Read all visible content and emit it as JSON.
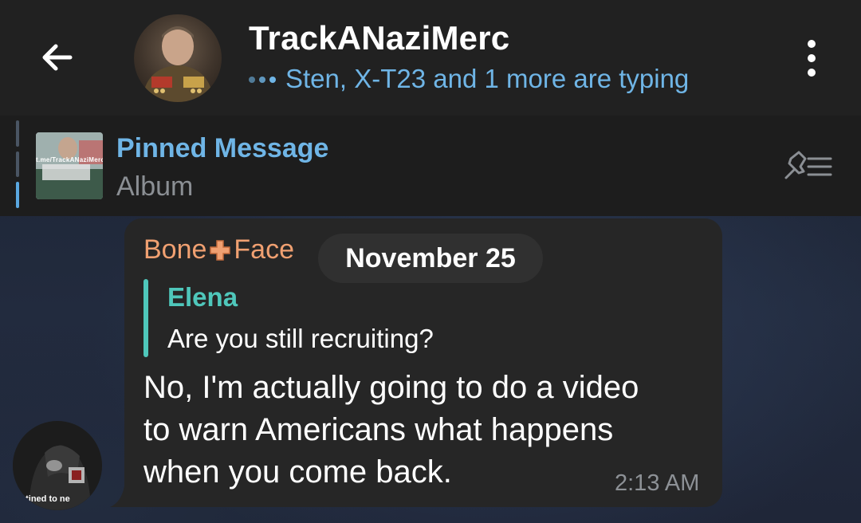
{
  "header": {
    "back_icon": "arrow-left-icon",
    "title": "TrackANaziMerc",
    "status": "Sten, X-T23 and 1 more are typing",
    "menu_icon": "more-vertical-icon"
  },
  "pinned": {
    "title": "Pinned Message",
    "subtitle": "Album",
    "thumbnail_text": "t.me/TrackANaziMerc",
    "list_icon": "pinned-list-icon"
  },
  "chat": {
    "date": "November 25",
    "message": {
      "sender_name_part1": "Bone",
      "sender_icon": "cross-icon",
      "sender_name_part2": "Face",
      "reply": {
        "author": "Elena",
        "text": "Are you still recruiting?"
      },
      "text_lines": [
        "No, I'm actually going to do a video",
        "to warn Americans what happens",
        "when you come back."
      ],
      "time": "2:13 AM",
      "avatar_caption": "stined to ne"
    }
  },
  "colors": {
    "header_bg": "#212121",
    "accent_blue": "#6fb5e6",
    "sender_orange": "#f0a071",
    "reply_teal": "#4fc7bb",
    "bubble_bg": "#262626"
  }
}
